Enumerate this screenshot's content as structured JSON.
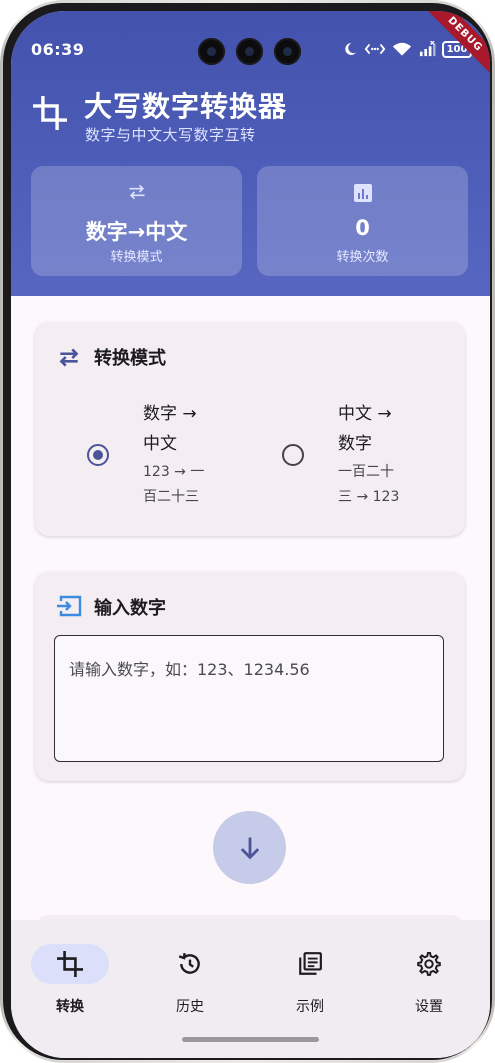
{
  "status_bar": {
    "time": "06:39",
    "battery": "100"
  },
  "debug_banner": "DEBUG",
  "header": {
    "icon": "crop-icon",
    "title": "大写数字转换器",
    "subtitle": "数字与中文大写数字互转"
  },
  "stats": [
    {
      "icon": "swap-arrows-icon",
      "value": "数字→中文",
      "label": "转换模式"
    },
    {
      "icon": "bar-chart-icon",
      "value": "0",
      "label": "转换次数"
    }
  ],
  "mode_card": {
    "icon": "swap-arrows-icon",
    "title": "转换模式",
    "options": [
      {
        "title_line1": "数字 →",
        "title_line2": "中文",
        "example_line1": "123 → 一",
        "example_line2": "百二十三",
        "selected": true
      },
      {
        "title_line1": "中文 →",
        "title_line2": "数字",
        "example_line1": "一百二十",
        "example_line2": "三 → 123",
        "selected": false
      }
    ]
  },
  "input_card": {
    "icon": "input-icon",
    "title": "输入数字",
    "placeholder": "请输入数字，如：123、1234.56",
    "value": ""
  },
  "convert_button": {
    "icon": "arrow-down-icon"
  },
  "bottom_nav": [
    {
      "icon": "crop-icon",
      "label": "转换",
      "active": true
    },
    {
      "icon": "history-icon",
      "label": "历史",
      "active": false
    },
    {
      "icon": "library-books-icon",
      "label": "示例",
      "active": false
    },
    {
      "icon": "settings-gear-icon",
      "label": "设置",
      "active": false
    }
  ],
  "colors": {
    "primary": "#4352ad",
    "accent": "#4a5598",
    "fab": "#c6cbea",
    "nav_active": "#dcdff9",
    "input_icon": "#3d8be0"
  }
}
